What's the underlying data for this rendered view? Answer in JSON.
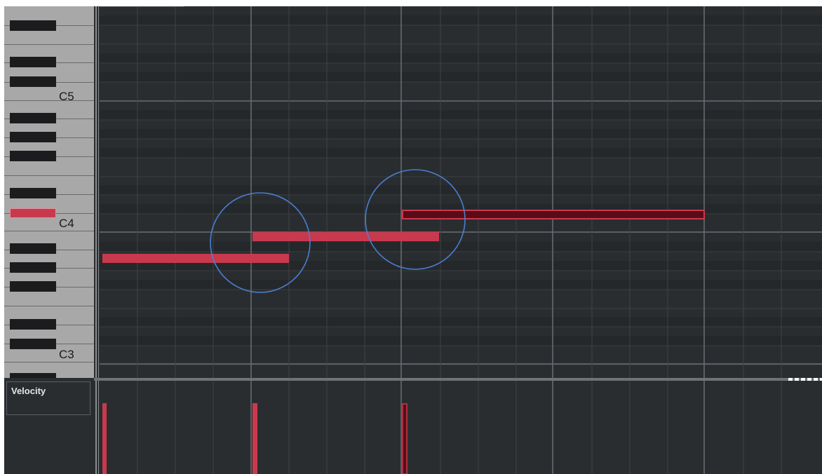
{
  "piano_roll": {
    "octave_labels": [
      "C5",
      "C4",
      "C3"
    ],
    "active_key": "C4",
    "note_color": "#c9394e",
    "selected_note_color": "#5a0c16",
    "grid_background": "#2a2d30",
    "highlight_circle_color": "#4a7fd0",
    "notes": [
      {
        "pitch": "A#3",
        "selected": false,
        "velocity": 1.0
      },
      {
        "pitch": "B3",
        "selected": false,
        "velocity": 1.0
      },
      {
        "pitch": "C#4",
        "selected": true,
        "velocity": 1.0
      }
    ],
    "highlight_circles": 2
  },
  "velocity_lane": {
    "label": "Velocity"
  }
}
